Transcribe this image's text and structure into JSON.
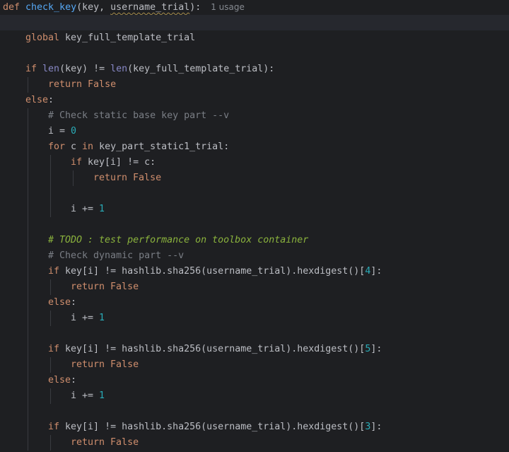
{
  "editor": {
    "language": "python",
    "usage_hint": "1 usage",
    "lines": [
      {
        "indent": 0,
        "tokens": [
          [
            "kw",
            "def "
          ],
          [
            "fn",
            "check_key"
          ],
          [
            "plain",
            "(key, "
          ],
          [
            "plain-sq",
            "username_trial"
          ],
          [
            "plain",
            "):"
          ]
        ],
        "usage": true
      },
      {
        "indent": 0,
        "tokens": [],
        "current": true
      },
      {
        "indent": 1,
        "tokens": [
          [
            "kw",
            "global "
          ],
          [
            "plain",
            "key_full_template_trial"
          ]
        ]
      },
      {
        "indent": 0,
        "tokens": []
      },
      {
        "indent": 1,
        "tokens": [
          [
            "kw",
            "if "
          ],
          [
            "builtin",
            "len"
          ],
          [
            "plain",
            "(key) != "
          ],
          [
            "builtin",
            "len"
          ],
          [
            "plain",
            "(key_full_template_trial):"
          ]
        ]
      },
      {
        "indent": 2,
        "tokens": [
          [
            "kw",
            "return "
          ],
          [
            "kw",
            "False"
          ]
        ]
      },
      {
        "indent": 1,
        "tokens": [
          [
            "kw",
            "else"
          ],
          [
            "plain",
            ":"
          ]
        ]
      },
      {
        "indent": 2,
        "tokens": [
          [
            "cmt",
            "# Check static base key part --v"
          ]
        ]
      },
      {
        "indent": 2,
        "tokens": [
          [
            "plain",
            "i = "
          ],
          [
            "num",
            "0"
          ]
        ]
      },
      {
        "indent": 2,
        "tokens": [
          [
            "kw",
            "for "
          ],
          [
            "plain",
            "c "
          ],
          [
            "kw",
            "in "
          ],
          [
            "plain",
            "key_part_static1_trial:"
          ]
        ]
      },
      {
        "indent": 3,
        "tokens": [
          [
            "kw",
            "if "
          ],
          [
            "plain",
            "key[i] != c:"
          ]
        ]
      },
      {
        "indent": 4,
        "tokens": [
          [
            "kw",
            "return "
          ],
          [
            "kw",
            "False"
          ]
        ]
      },
      {
        "indent": 0,
        "tokens": []
      },
      {
        "indent": 3,
        "tokens": [
          [
            "plain",
            "i += "
          ],
          [
            "num",
            "1"
          ]
        ]
      },
      {
        "indent": 0,
        "tokens": []
      },
      {
        "indent": 2,
        "tokens": [
          [
            "todo",
            "# TODO : test performance on toolbox container"
          ]
        ]
      },
      {
        "indent": 2,
        "tokens": [
          [
            "cmt",
            "# Check dynamic part --v"
          ]
        ]
      },
      {
        "indent": 2,
        "tokens": [
          [
            "kw",
            "if "
          ],
          [
            "plain",
            "key[i] != hashlib.sha256(username_trial).hexdigest()["
          ],
          [
            "num",
            "4"
          ],
          [
            "plain",
            "]:"
          ]
        ]
      },
      {
        "indent": 3,
        "tokens": [
          [
            "kw",
            "return "
          ],
          [
            "kw",
            "False"
          ]
        ]
      },
      {
        "indent": 2,
        "tokens": [
          [
            "kw",
            "else"
          ],
          [
            "plain",
            ":"
          ]
        ]
      },
      {
        "indent": 3,
        "tokens": [
          [
            "plain",
            "i += "
          ],
          [
            "num",
            "1"
          ]
        ]
      },
      {
        "indent": 0,
        "tokens": []
      },
      {
        "indent": 2,
        "tokens": [
          [
            "kw",
            "if "
          ],
          [
            "plain",
            "key[i] != hashlib.sha256(username_trial).hexdigest()["
          ],
          [
            "num",
            "5"
          ],
          [
            "plain",
            "]:"
          ]
        ]
      },
      {
        "indent": 3,
        "tokens": [
          [
            "kw",
            "return "
          ],
          [
            "kw",
            "False"
          ]
        ]
      },
      {
        "indent": 2,
        "tokens": [
          [
            "kw",
            "else"
          ],
          [
            "plain",
            ":"
          ]
        ]
      },
      {
        "indent": 3,
        "tokens": [
          [
            "plain",
            "i += "
          ],
          [
            "num",
            "1"
          ]
        ]
      },
      {
        "indent": 0,
        "tokens": []
      },
      {
        "indent": 2,
        "tokens": [
          [
            "kw",
            "if "
          ],
          [
            "plain",
            "key[i] != hashlib.sha256(username_trial).hexdigest()["
          ],
          [
            "num",
            "3"
          ],
          [
            "plain",
            "]:"
          ]
        ]
      },
      {
        "indent": 3,
        "tokens": [
          [
            "kw",
            "return "
          ],
          [
            "kw",
            "False"
          ]
        ]
      }
    ]
  },
  "colors": {
    "background": "#1e1f22",
    "keyword": "#cf8e6d",
    "function": "#56a8f5",
    "builtin": "#8888c6",
    "number": "#2aacb8",
    "comment": "#7a7e85",
    "todo": "#8bb33d"
  }
}
